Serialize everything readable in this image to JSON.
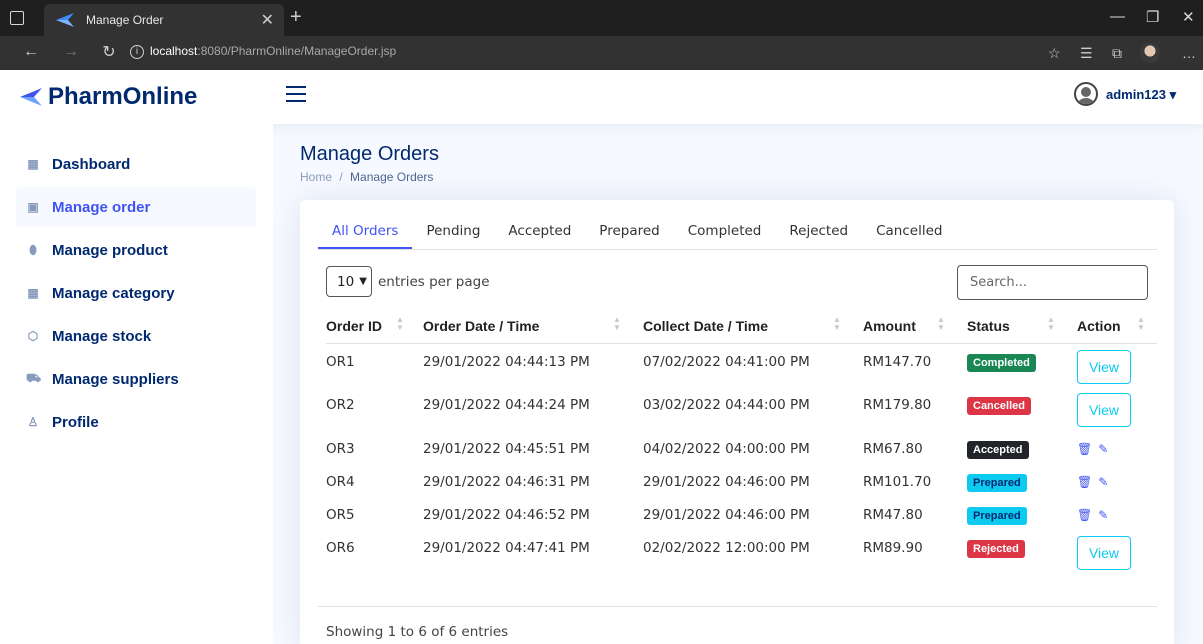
{
  "browser": {
    "tab_title": "Manage Order",
    "url_host": "localhost",
    "url_rest": ":8080/PharmOnline/ManageOrder.jsp"
  },
  "header": {
    "logo_text": "PharmOnline",
    "username": "admin123 ▾"
  },
  "sidebar": {
    "items": [
      {
        "label": "Dashboard",
        "icon": "grid-icon"
      },
      {
        "label": "Manage order",
        "icon": "clipboard-icon"
      },
      {
        "label": "Manage product",
        "icon": "pill-icon"
      },
      {
        "label": "Manage category",
        "icon": "grid-icon"
      },
      {
        "label": "Manage stock",
        "icon": "box-icon"
      },
      {
        "label": "Manage suppliers",
        "icon": "truck-icon"
      },
      {
        "label": "Profile",
        "icon": "person-icon"
      }
    ]
  },
  "page": {
    "title": "Manage Orders",
    "breadcrumb_home": "Home",
    "breadcrumb_sep": "/",
    "breadcrumb_current": "Manage Orders"
  },
  "tabs": [
    "All Orders",
    "Pending",
    "Accepted",
    "Prepared",
    "Completed",
    "Rejected",
    "Cancelled"
  ],
  "table_controls": {
    "per_page_value": "10",
    "per_page_label": "entries per page",
    "search_placeholder": "Search..."
  },
  "table": {
    "headers": [
      "Order ID",
      "Order Date / Time",
      "Collect Date / Time",
      "Amount",
      "Status",
      "Action"
    ],
    "rows": [
      {
        "id": "OR1",
        "order_dt": "29/01/2022 04:44:13 PM",
        "collect_dt": "07/02/2022 04:41:00 PM",
        "amount": "RM147.70",
        "status": "Completed",
        "action": "View"
      },
      {
        "id": "OR2",
        "order_dt": "29/01/2022 04:44:24 PM",
        "collect_dt": "03/02/2022 04:44:00 PM",
        "amount": "RM179.80",
        "status": "Cancelled",
        "action": "View"
      },
      {
        "id": "OR3",
        "order_dt": "29/01/2022 04:45:51 PM",
        "collect_dt": "04/02/2022 04:00:00 PM",
        "amount": "RM67.80",
        "status": "Accepted",
        "action": "icons"
      },
      {
        "id": "OR4",
        "order_dt": "29/01/2022 04:46:31 PM",
        "collect_dt": "29/01/2022 04:46:00 PM",
        "amount": "RM101.70",
        "status": "Prepared",
        "action": "icons"
      },
      {
        "id": "OR5",
        "order_dt": "29/01/2022 04:46:52 PM",
        "collect_dt": "29/01/2022 04:46:00 PM",
        "amount": "RM47.80",
        "status": "Prepared",
        "action": "icons"
      },
      {
        "id": "OR6",
        "order_dt": "29/01/2022 04:47:41 PM",
        "collect_dt": "02/02/2022 12:00:00 PM",
        "amount": "RM89.90",
        "status": "Rejected",
        "action": "View"
      }
    ]
  },
  "status_colors": {
    "Completed": "#198754",
    "Cancelled": "#dc3545",
    "Accepted": "#212529",
    "Prepared": "#0dcaf0",
    "Rejected": "#dc3545"
  },
  "footer": {
    "showing": "Showing 1 to 6 of 6 entries"
  },
  "colors": {
    "brand": "#012970",
    "accent": "#4154f1",
    "logo_blue": "#4154f1"
  }
}
